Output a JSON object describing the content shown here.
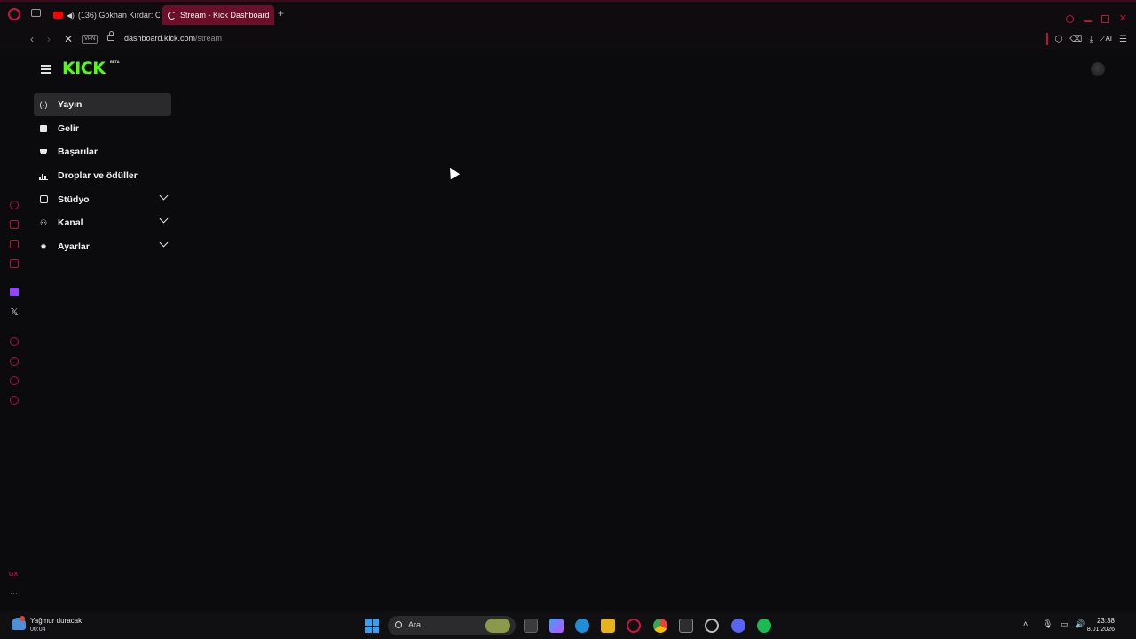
{
  "browser": {
    "tabs": [
      {
        "label": "(136) Gökhan Kırdar: C",
        "icon": "youtube-icon",
        "audio_icon": "speaker-icon"
      },
      {
        "label": "Stream - Kick Dashboard",
        "icon": "loading-spinner-icon",
        "active": true
      }
    ],
    "new_tab_glyph": "+",
    "vpn_label": "VPN",
    "url_host": "dashboard.kick.com",
    "url_path": "/stream",
    "ai_label": "AI",
    "accent_color": "#c2103a"
  },
  "kick": {
    "logo": "KICK",
    "logo_badge": "BETA",
    "brand_color": "#53fc18",
    "nav": [
      {
        "label": "Yayın",
        "icon": "broadcast-icon",
        "active": true
      },
      {
        "label": "Gelir",
        "icon": "revenue-icon"
      },
      {
        "label": "Başarılar",
        "icon": "trophy-icon"
      },
      {
        "label": "Droplar ve ödüller",
        "icon": "drops-chart-icon"
      },
      {
        "label": "Stüdyo",
        "icon": "studio-icon",
        "expandable": true
      },
      {
        "label": "Kanal",
        "icon": "channel-users-icon",
        "expandable": true
      },
      {
        "label": "Ayarlar",
        "icon": "settings-gear-icon",
        "expandable": true
      }
    ]
  },
  "opera_sidebar": {
    "gx_label": "GX",
    "more_label": "···"
  },
  "taskbar": {
    "weather_text": "Yağmur duracak",
    "weather_time": "00:04",
    "search_label": "Ara",
    "time": "23:38",
    "date": "8.01.2026"
  }
}
